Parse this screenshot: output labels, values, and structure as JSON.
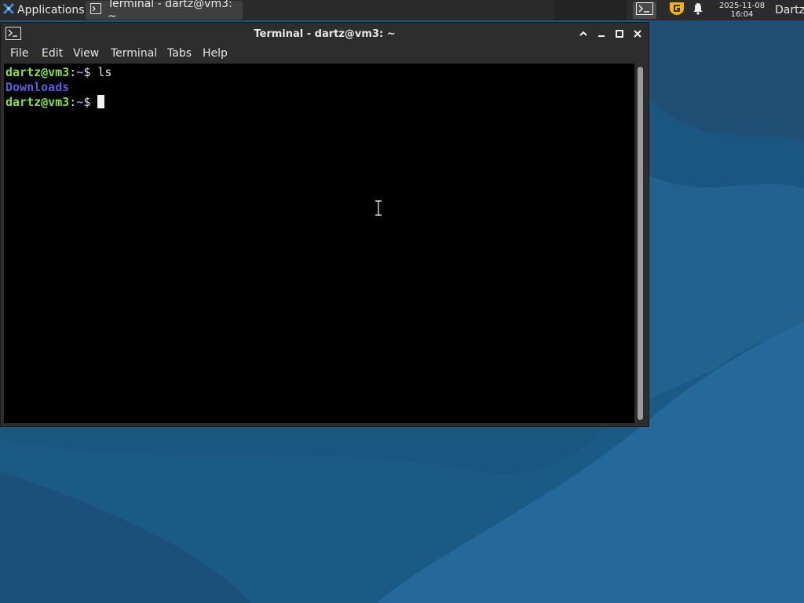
{
  "panel": {
    "apps_label": "Applications",
    "apps_separator": "≡",
    "task_title": "Terminal - dartz@vm3: ~",
    "clock_date": "2025-11-08",
    "clock_time": "16:04",
    "user": "Dartz",
    "icons": [
      "apps-logo-icon",
      "terminal-icon",
      "g-shield-icon",
      "bell-icon"
    ]
  },
  "window": {
    "title": "Terminal - dartz@vm3: ~",
    "menu": [
      "File",
      "Edit",
      "View",
      "Terminal",
      "Tabs",
      "Help"
    ],
    "controls": [
      "shade-icon",
      "minimize-icon",
      "maximize-icon",
      "close-icon"
    ]
  },
  "terminal": {
    "lines": [
      {
        "user": "dartz@vm3",
        "sep": ":",
        "path": "~",
        "symbol": "$ ",
        "command": "ls"
      },
      {
        "output": "Downloads"
      },
      {
        "user": "dartz@vm3",
        "sep": ":",
        "path": "~",
        "symbol": "$ ",
        "command": ""
      }
    ]
  },
  "colors": {
    "prompt_user": "#8ae234",
    "prompt_path": "#729fcf",
    "directory": "#5b5bdf",
    "wallpaper": "#1d5b86"
  }
}
